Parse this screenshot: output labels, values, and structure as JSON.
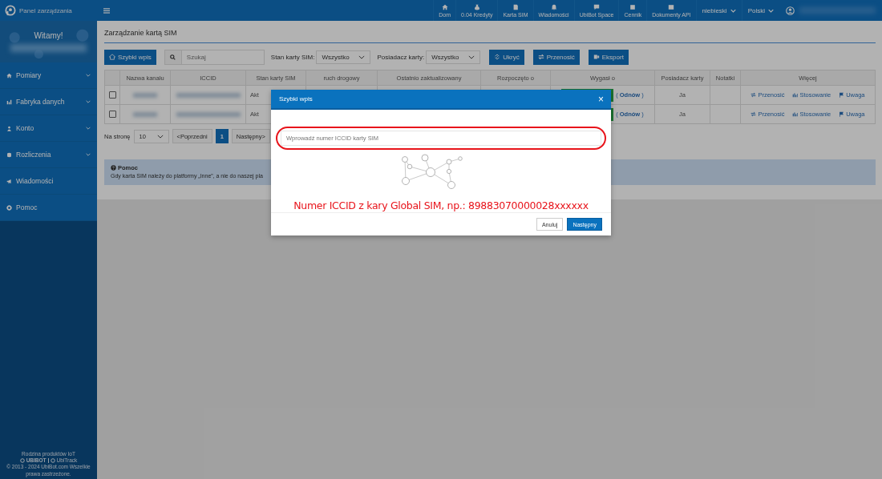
{
  "brand": {
    "title": "Panel zarządzania"
  },
  "topnav": [
    {
      "label": "Dom"
    },
    {
      "label": "0.04 Kredyty"
    },
    {
      "label": "Karta SIM"
    },
    {
      "label": "Wiadomości"
    },
    {
      "label": "UbiBot Space"
    },
    {
      "label": "Cennik"
    },
    {
      "label": "Dokumenty API"
    }
  ],
  "top_dropdowns": [
    "niebieski",
    "Polski"
  ],
  "sidebar": {
    "welcome": "Witamy!",
    "items": [
      {
        "label": "Pomiary",
        "expandable": true
      },
      {
        "label": "Fabryka danych",
        "expandable": true
      },
      {
        "label": "Konto",
        "expandable": true
      },
      {
        "label": "Rozliczenia",
        "expandable": true
      },
      {
        "label": "Wiadomości",
        "expandable": false
      },
      {
        "label": "Pomoc",
        "expandable": false
      }
    ],
    "footer": {
      "family": "Rodzina produktów IoT",
      "brands": [
        "UBIBOT",
        "UbiTrack"
      ],
      "copyright": "© 2013 - 2024 UbiBot.com Wszelkie prawa zastrzeżone."
    }
  },
  "page": {
    "title": "Zarządzanie kartą SIM"
  },
  "toolbar": {
    "quick_button": "Szybki wpis",
    "search": {
      "placeholder": "Szukaj"
    },
    "filters": [
      {
        "label": "Stan karty SIM:",
        "value": "Wszystko"
      },
      {
        "label": "Posiadacz karty:",
        "value": "Wszystko"
      }
    ],
    "buttons": [
      "Ukryć",
      "Przenosić",
      "Eksport"
    ]
  },
  "table": {
    "columns": [
      "Nazwa kanału",
      "ICCID",
      "Stan karty SIM",
      "ruch drogowy",
      "Ostatnio zaktualizowany",
      "Rozpoczęto o",
      "Wygasł o",
      "Posiadacz karty",
      "Notatki",
      "Więcej"
    ],
    "rows": [
      {
        "checked": false,
        "state": "Akt",
        "renew": "(**Odnów**)",
        "holder": "Ja",
        "actions": [
          "Przenosić",
          "Stosowanie",
          "Uwaga"
        ]
      },
      {
        "checked": false,
        "state": "Akt",
        "renew": "(**Odnów**)",
        "holder": "Ja",
        "actions": [
          "Przenosić",
          "Stosowanie",
          "Uwaga"
        ]
      }
    ]
  },
  "pagination": {
    "per_page_label": "Na stronę",
    "per_page": "10",
    "prev": "<Poprzedni",
    "pages": [
      {
        "label": "1",
        "selected": true
      }
    ],
    "next": "Następny>"
  },
  "help": {
    "title": "Pomoc",
    "text": "Gdy karta SIM należy do platformy „Inne”, a nie do naszej pla"
  },
  "modal": {
    "title": "Szybki wpis",
    "close": "×",
    "input": {
      "placeholder": "Wprowadź numer ICCID karty SIM"
    },
    "note": "Numer ICCID z kary Global SIM, np.: 89883070000028xxxxxx",
    "buttons": [
      {
        "label": "Anuluj",
        "primary": false
      },
      {
        "label": "Następny",
        "primary": true
      }
    ]
  }
}
